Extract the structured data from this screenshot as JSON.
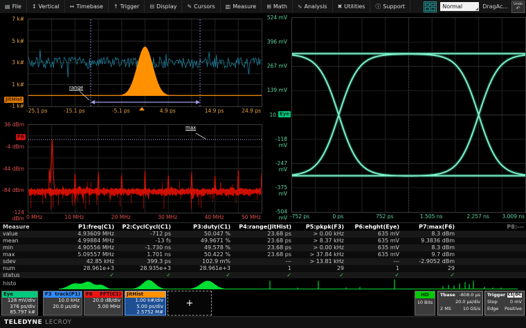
{
  "menu": {
    "items": [
      {
        "label": "File",
        "icon": "file-icon",
        "glyph": "▤"
      },
      {
        "label": "Vertical",
        "icon": "vertical-arrows-icon",
        "glyph": "↕"
      },
      {
        "label": "Timebase",
        "icon": "horizontal-arrows-icon",
        "glyph": "↔"
      },
      {
        "label": "Trigger",
        "icon": "trigger-arrow-icon",
        "glyph": "↑"
      },
      {
        "label": "Display",
        "icon": "display-icon",
        "glyph": "⊟"
      },
      {
        "label": "Cursors",
        "icon": "cursor-pencil-icon",
        "glyph": "✎"
      },
      {
        "label": "Measure",
        "icon": "ruler-icon",
        "glyph": "▥"
      },
      {
        "label": "Math",
        "icon": "calculator-icon",
        "glyph": "⊞"
      },
      {
        "label": "Analysis",
        "icon": "analysis-wave-icon",
        "glyph": "∿"
      },
      {
        "label": "Utilities",
        "icon": "utilities-icon",
        "glyph": "✖"
      },
      {
        "label": "Support",
        "icon": "support-info-icon",
        "glyph": "ⓘ"
      }
    ],
    "view_mode": "Normal",
    "drag_label": "DragAc...",
    "undo_label": "Undo",
    "undo_glyph": "↶"
  },
  "jitter_histogram": {
    "badge": "JitHist",
    "y_ticks": [
      "7 k#",
      "5 k#",
      "3 k#",
      "1 k#",
      "-1 k#"
    ],
    "x_ticks": [
      "-25.1 ps",
      "-15.1 ps",
      "-5.1 ps",
      "4.9 ps",
      "14.9 ps",
      "24.9 ps"
    ],
    "range_label": "range",
    "trace_color": "#ff9100",
    "noise_color": "#1d89a8",
    "cursor_color": "#8585d8",
    "tick_color": "#e3a342"
  },
  "spectrum": {
    "badge": "F6",
    "y_ticks": [
      "36 dBm",
      "-4 dBm",
      "-44 dBm",
      "-84 dBm",
      "-124 dBm"
    ],
    "x_ticks": [
      "0 MHz",
      "10 MHz",
      "20 MHz",
      "30 MHz",
      "40 MHz",
      "50 MHz"
    ],
    "max_label": "max",
    "trace_color": "#ee1100",
    "cursor_color": "#c8c8ff",
    "tick_color": "#e05050"
  },
  "eye_diagram": {
    "badge": "Eye",
    "y_ticks": [
      "524 mV",
      "396 mV",
      "267 mV",
      "139 mV",
      "10",
      "-118 mV",
      "-247 mV",
      "-375 mV",
      "-504 mV"
    ],
    "x_ticks": [
      "-752 ps",
      "0 ps",
      "752 ps",
      "1.505 ns",
      "2.257 ns",
      "3.009 ns"
    ],
    "trace_color": "#7df2c8",
    "tick_color": "#5fd6a0"
  },
  "measure": {
    "title": "Measure",
    "columns": [
      "P1:freq(C1)",
      "P2:CyclCycl(C1)",
      "P3:duty(C1)",
      "P4:range(JitHist)",
      "P5:pkpk(F3)",
      "P6:ehght(Eye)",
      "P7:max(F6)",
      "P8:---"
    ],
    "rows": [
      {
        "label": "value",
        "cells": [
          "4.93609 MHz",
          "-712 ps",
          "50.047 %",
          "23.68 ps",
          "> 0.00 kHz",
          "635 mV",
          "8.3 dBm",
          ""
        ]
      },
      {
        "label": "mean",
        "cells": [
          "4.99884 MHz",
          "-13 fs",
          "49.9671 %",
          "23.68 ps",
          "> 8.37 kHz",
          "635 mV",
          "9.3836 dBm",
          ""
        ]
      },
      {
        "label": "min",
        "cells": [
          "4.90556 MHz",
          "-1.730 ns",
          "49.578 %",
          "23.68 ps",
          "> 0.00 kHz",
          "635 mV",
          "8.3 dBm",
          ""
        ]
      },
      {
        "label": "max",
        "cells": [
          "5.09557 MHz",
          "1.701 ns",
          "50.422 %",
          "23.68 ps",
          "> 37.84 kHz",
          "635 mV",
          "9.7 dBm",
          ""
        ]
      },
      {
        "label": "sdev",
        "cells": [
          "42.85 kHz",
          "399.3 ps",
          "102.9 m%",
          "---",
          "> 13.81 kHz",
          "---",
          "-2.9052 dBm",
          ""
        ]
      },
      {
        "label": "num",
        "cells": [
          "28.961e+3",
          "28.935e+3",
          "28.961e+3",
          "1",
          "29",
          "1",
          "29",
          ""
        ]
      }
    ],
    "status": {
      "label": "status",
      "check_glyph": "✓",
      "checks": [
        true,
        true,
        true,
        true,
        true,
        true,
        true,
        false
      ]
    },
    "histo_label": "histo",
    "histo_color": "#00dd33"
  },
  "descriptors": [
    {
      "id": "eye",
      "header_left": "Eye",
      "header_right": "",
      "header_color": "#00c97e",
      "lines": [
        {
          "left": "",
          "right": "128 mV/div"
        },
        {
          "left": "",
          "right": "376 ps/div"
        },
        {
          "left": "",
          "right": "85.797 k#"
        }
      ],
      "selected": false
    },
    {
      "id": "f3",
      "header_left": "F3",
      "header_right": "track(P1)",
      "header_color": "#2e8bff",
      "lines": [
        {
          "left": "",
          "right": "10.0 kHz"
        },
        {
          "left": "",
          "right": "20.0 µs/div"
        }
      ],
      "selected": false
    },
    {
      "id": "f6",
      "header_left": "F6",
      "header_right": "FFT(C1)",
      "header_color": "#ee1111",
      "lines": [
        {
          "left": "",
          "right": "20.0 dB/div"
        },
        {
          "left": "",
          "right": "5.00 MHz"
        }
      ],
      "selected": false
    },
    {
      "id": "jithist",
      "header_left": "JitHist",
      "header_right": "",
      "header_color": "#ff9100",
      "lines": [
        {
          "left": "",
          "right": "1.00 k#/div"
        },
        {
          "left": "",
          "right": "5.00 ps/div"
        },
        {
          "left": "",
          "right": "2.5752 M#"
        }
      ],
      "selected": true
    }
  ],
  "add_trace_label": "+",
  "acquisition": {
    "hd": {
      "label": "HD",
      "bits": "10 Bits",
      "color": "#00cc00"
    },
    "timebase": {
      "label": "Tbase",
      "offset": "-808.0 µs",
      "scale": "20.0 µs/div",
      "samples": "2 MS",
      "rate": "10 GS/s"
    },
    "trigger": {
      "label": "Trigger",
      "source": "C1",
      "coupling": "DC",
      "mode": "Stop",
      "level": "0 mV",
      "type": "Edge",
      "slope": "Positive"
    }
  },
  "footer": {
    "brand_primary": "TELEDYNE",
    "brand_secondary": "LECROY"
  },
  "chart_data": [
    {
      "type": "area",
      "name": "jitter-histogram",
      "title": "JitHist",
      "xlabel_unit": "ps",
      "x_range": [
        -25.1,
        24.9
      ],
      "y_range_k": [
        -1,
        7
      ],
      "gaussian_peak": {
        "x_ps": 0,
        "height_k": 4.5,
        "sigma_ps": 1.7
      },
      "noise_band_level_k": 3,
      "range_cursors_ps": [
        -11.7,
        12.0
      ],
      "x_div": "5.00 ps/div",
      "y_div": "1.00 k#/div"
    },
    {
      "type": "line",
      "name": "fft-spectrum",
      "title": "F6 FFT(C1)",
      "x_range_mhz": [
        0,
        50
      ],
      "y_range_dbm": [
        36,
        -124
      ],
      "noise_floor_dbm": -84,
      "fundamental": {
        "freq_mhz": 5,
        "level_dbm": 8.3
      },
      "harmonics_spacing_mhz": 5,
      "harmonic_level_dbm": -52,
      "max_cursor_dbm": 8.3,
      "x_div": "5.00 MHz",
      "y_div": "20.0 dB/div"
    },
    {
      "type": "line",
      "name": "eye-diagram",
      "title": "Eye",
      "x_ticks": [
        "-752 ps",
        "0 ps",
        "752 ps",
        "1.505 ns",
        "2.257 ns",
        "3.009 ns"
      ],
      "y_range_mv": [
        524,
        -504
      ],
      "rail_high_mv": 335,
      "rail_low_mv": -312,
      "crossing_level_mv": 10,
      "crossing_times": [
        "0 ps",
        "2.257 ns"
      ],
      "eye_height_mv": 635,
      "x_div": "376 ps/div",
      "y_div": "128 mV/div"
    }
  ]
}
